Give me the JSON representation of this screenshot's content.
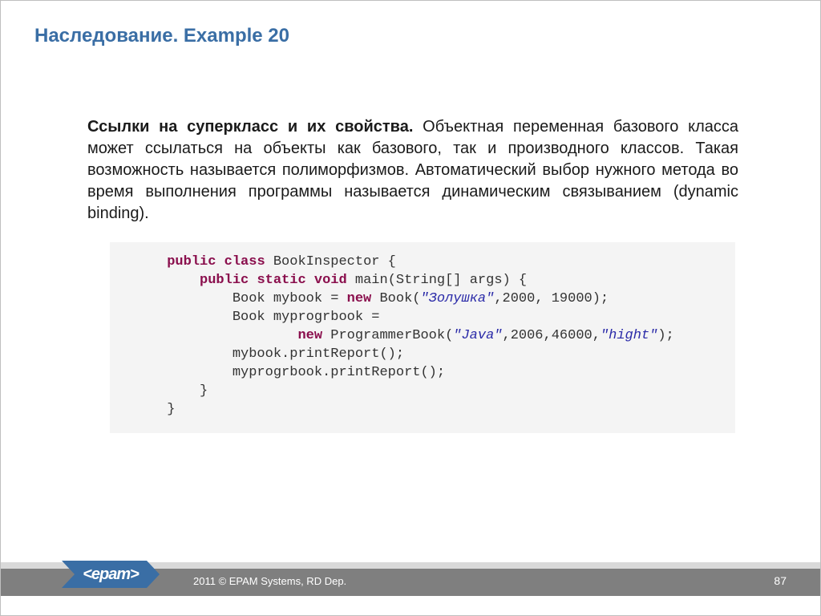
{
  "title": "Наследование. Example 20",
  "paragraph": {
    "lead": "Ссылки на суперкласс и их свойства.",
    "rest": " Объектная переменная базового класса может ссылаться на объекты как базового, так и производного классов. Такая возможность называется полиморфизмов. Автоматический выбор нужного метода во время выполнения программы называется динамическим связыванием (dynamic binding)."
  },
  "code": {
    "l1a": "public",
    "l1b": " ",
    "l1c": "class",
    "l1d": " BookInspector {",
    "l2a": "public",
    "l2b": " ",
    "l2c": "static",
    "l2d": " ",
    "l2e": "void",
    "l2f": " main(String[] args) {",
    "l3a": "Book mybook = ",
    "l3b": "new",
    "l3c": " Book(",
    "l3d": "\"Золушка\"",
    "l3e": ",2000, 19000);",
    "l4": "Book myprogrbook =",
    "l5a": "new",
    "l5b": " ProgrammerBook(",
    "l5c": "\"Java\"",
    "l5d": ",2006,46000,",
    "l5e": "\"hight\"",
    "l5f": ");",
    "l6": "mybook.printReport();",
    "l7": "myprogrbook.printReport();",
    "l8": "}",
    "l9": "}"
  },
  "footer": {
    "logo": "<epam>",
    "copyright": "2011 © EPAM Systems, RD Dep.",
    "page": "87"
  }
}
